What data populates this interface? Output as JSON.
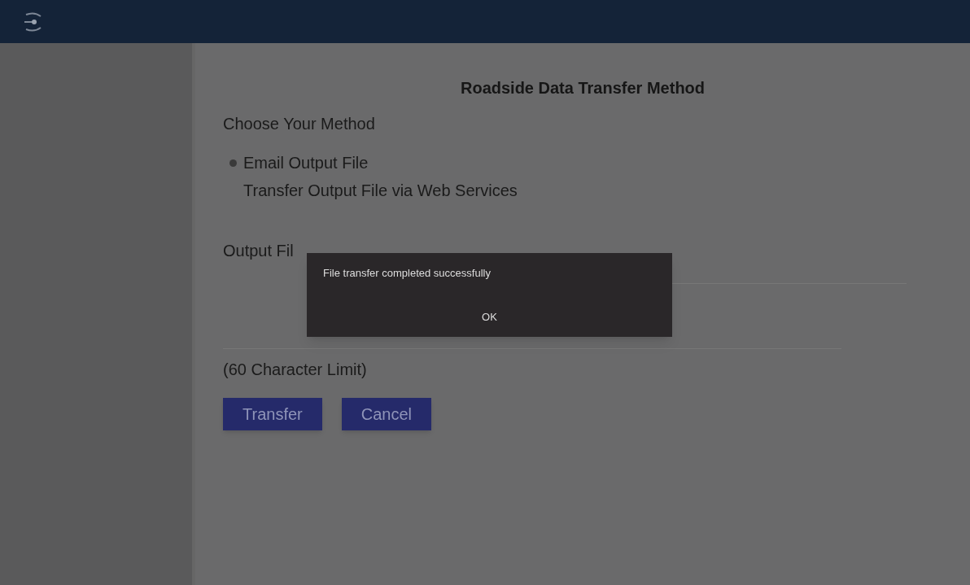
{
  "page": {
    "title": "Roadside Data Transfer Method"
  },
  "method": {
    "heading": "Choose Your Method",
    "options": [
      {
        "label": "Email Output File",
        "selected": true
      },
      {
        "label": "Transfer Output File via Web Services",
        "selected": false
      }
    ]
  },
  "comment": {
    "label": "Output Fil",
    "limit": "(60 Character Limit)"
  },
  "buttons": [
    {
      "label": "Transfer"
    },
    {
      "label": "Cancel"
    }
  ],
  "dialog": {
    "message": "File transfer completed successfully",
    "button": "OK"
  }
}
